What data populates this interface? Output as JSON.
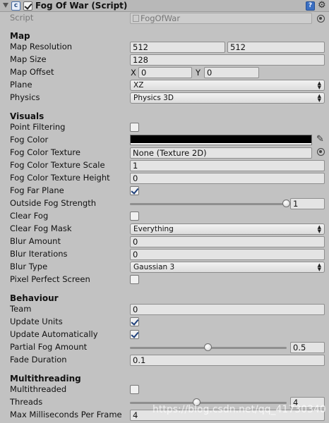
{
  "component": {
    "title": "Fog Of War (Script)"
  },
  "script_row": {
    "label": "Script",
    "value": "FogOfWar"
  },
  "sections": {
    "map": "Map",
    "visuals": "Visuals",
    "behaviour": "Behaviour",
    "multithreading": "Multithreading"
  },
  "map": {
    "resolution_label": "Map Resolution",
    "resolution_x": "512",
    "resolution_y": "512",
    "size_label": "Map Size",
    "size": "128",
    "offset_label": "Map Offset",
    "offset_x_axis": "X",
    "offset_x": "0",
    "offset_y_axis": "Y",
    "offset_y": "0",
    "plane_label": "Plane",
    "plane": "XZ",
    "physics_label": "Physics",
    "physics": "Physics 3D"
  },
  "visuals": {
    "point_filtering_label": "Point Filtering",
    "point_filtering": false,
    "fog_color_label": "Fog Color",
    "fog_color": "#000000",
    "fog_color_texture_label": "Fog Color Texture",
    "fog_color_texture": "None (Texture 2D)",
    "fog_color_texture_scale_label": "Fog Color Texture Scale",
    "fog_color_texture_scale": "1",
    "fog_color_texture_height_label": "Fog Color Texture Height",
    "fog_color_texture_height": "0",
    "fog_far_plane_label": "Fog Far Plane",
    "fog_far_plane": true,
    "outside_fog_strength_label": "Outside Fog Strength",
    "outside_fog_strength": "1",
    "outside_fog_strength_fraction": 1.0,
    "clear_fog_label": "Clear Fog",
    "clear_fog": false,
    "clear_fog_mask_label": "Clear Fog Mask",
    "clear_fog_mask": "Everything",
    "blur_amount_label": "Blur Amount",
    "blur_amount": "0",
    "blur_iterations_label": "Blur Iterations",
    "blur_iterations": "0",
    "blur_type_label": "Blur Type",
    "blur_type": "Gaussian 3",
    "pixel_perfect_label": "Pixel Perfect Screen",
    "pixel_perfect": false
  },
  "behaviour": {
    "team_label": "Team",
    "team": "0",
    "update_units_label": "Update Units",
    "update_units": true,
    "update_auto_label": "Update Automatically",
    "update_auto": true,
    "partial_fog_label": "Partial Fog Amount",
    "partial_fog": "0.5",
    "partial_fog_fraction": 0.5,
    "fade_duration_label": "Fade Duration",
    "fade_duration": "0.1"
  },
  "multithreading": {
    "multithreaded_label": "Multithreaded",
    "multithreaded": false,
    "threads_label": "Threads",
    "threads": "4",
    "threads_fraction": 0.43,
    "max_ms_label": "Max Milliseconds Per Frame",
    "max_ms": "4"
  },
  "watermark": "https://blog.csdn.net/qq_41730340",
  "icons": {
    "foldout": "chevron-down-icon",
    "script": "script-icon",
    "help": "help-icon",
    "settings": "gear-icon",
    "color_picker": "eyedropper-icon",
    "object_picker": "object-picker-icon"
  }
}
